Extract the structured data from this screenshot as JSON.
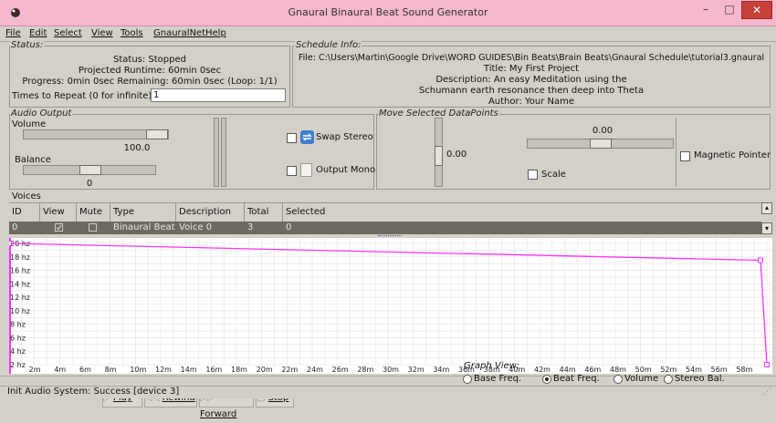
{
  "window": {
    "title": "Gnaural Binaural Beat Sound Generator",
    "close_label": "✕",
    "minimize_label": "–",
    "maximize_label": "□"
  },
  "menu": [
    "File",
    "Edit",
    "Select",
    "View",
    "Tools",
    "GnauralNet",
    "Help"
  ],
  "status": {
    "legend": "Status:",
    "status_line": "Status: Stopped",
    "runtime_line": "Projected Runtime: 60min 0sec",
    "progress_line": "Progress: 0min 0sec  Remaining: 60min 0sec (Loop: 1/1)",
    "repeat_label": "Times to Repeat (0 for infinite):",
    "repeat_value": "1"
  },
  "schedule": {
    "legend": "Schedule Info:",
    "file_line": "File: C:\\Users\\Martin\\Google Drive\\WORD GUIDES\\Bin Beats\\Brain Beats\\Gnaural Schedule\\tutorial3.gnaural",
    "title_line": "Title: My First Project",
    "desc_line1": "Description: An easy Meditation using the",
    "desc_line2": "Schumann earth resonance then deep into Theta",
    "author_line": "Author: Your Name"
  },
  "audio": {
    "legend": "Audio Output",
    "volume_label": "Volume",
    "volume_value": "100.0",
    "volume_level": 1.0,
    "balance_label": "Balance",
    "balance_value": "0",
    "balance_level": 0.5,
    "swap_stereo_label": "Swap Stereo",
    "output_mono_label": "Output Mono"
  },
  "move": {
    "legend": "Move Selected DataPoints",
    "vertical_value": "0.00",
    "horizontal_value": "0.00",
    "scale_label": "Scale",
    "magnetic_label": "Magnetic Pointer"
  },
  "voices": {
    "legend": "Voices",
    "columns": [
      "ID",
      "View",
      "Mute",
      "Type",
      "Description",
      "Total",
      "Selected"
    ],
    "row": {
      "id": "0",
      "type": "Binaural Beat",
      "description": "Voice 0",
      "total": "3",
      "selected": "0"
    }
  },
  "graph": {
    "y_labels": [
      "20 hz",
      "18 hz",
      "16 hz",
      "14 hz",
      "12 hz",
      "10 hz",
      "8 hz",
      "6 hz",
      "4 hz",
      "2 hz"
    ],
    "x_labels": [
      "2m",
      "4m",
      "6m",
      "8m",
      "10m",
      "12m",
      "14m",
      "16m",
      "18m",
      "20m",
      "22m",
      "24m",
      "26m",
      "28m",
      "30m",
      "32m",
      "34m",
      "36m",
      "38m",
      "40m",
      "42m",
      "44m",
      "46m",
      "48m",
      "50m",
      "52m",
      "54m",
      "56m",
      "58m"
    ],
    "line_color": "#ff33ff",
    "points": [
      {
        "t_min": 0,
        "hz": 20
      },
      {
        "t_min": 59.5,
        "hz": 17.5
      },
      {
        "t_min": 60,
        "hz": 2
      }
    ]
  },
  "transport": {
    "play": "Play",
    "rewind": "Rewind",
    "forward": "Forward",
    "stop": "Stop"
  },
  "graph_view": {
    "title": "Graph View:",
    "options": [
      "Base Freq.",
      "Beat Freq.",
      "Volume",
      "Stereo Bal."
    ],
    "selected": "Beat Freq."
  },
  "statusbar": {
    "text": "Init Audio System: Success [device 3]"
  }
}
